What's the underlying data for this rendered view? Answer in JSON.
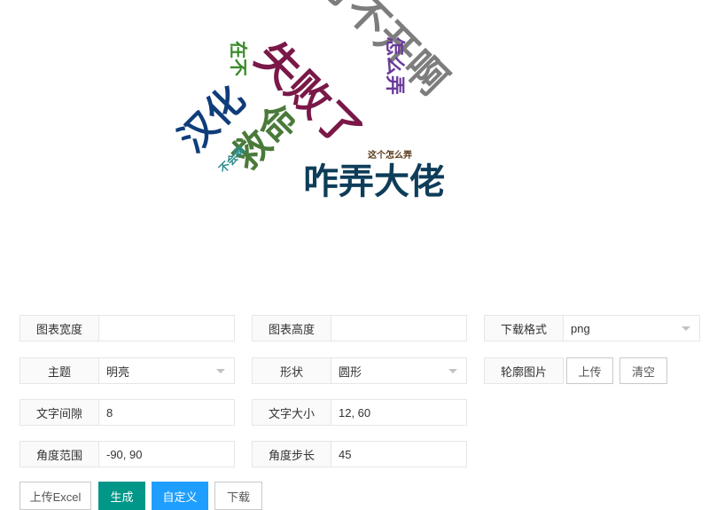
{
  "word_cloud": {
    "words": [
      {
        "text": "打不开啊",
        "color": "#7d7d7d"
      },
      {
        "text": "失败了",
        "color": "#7a1848"
      },
      {
        "text": "汉化",
        "color": "#0f3d7a"
      },
      {
        "text": "救命",
        "color": "#4a7a3a"
      },
      {
        "text": "咋弄大佬",
        "color": "#0e3d5a"
      },
      {
        "text": "怎么弄",
        "color": "#6a3a9a"
      },
      {
        "text": "在不",
        "color": "#3a8a2a"
      },
      {
        "text": "不会啊",
        "color": "#2a8a8a"
      },
      {
        "text": "这个怎么弄",
        "color": "#5a3a1a"
      }
    ]
  },
  "form": {
    "width_label": "图表宽度",
    "width_value": "",
    "height_label": "图表高度",
    "height_value": "",
    "format_label": "下载格式",
    "format_value": "png",
    "theme_label": "主题",
    "theme_value": "明亮",
    "shape_label": "形状",
    "shape_value": "圆形",
    "outline_label": "轮廓图片",
    "upload_label": "上传",
    "clear_label": "清空",
    "gap_label": "文字间隙",
    "gap_value": "8",
    "size_label": "文字大小",
    "size_value": "12, 60",
    "angle_range_label": "角度范围",
    "angle_range_value": "-90, 90",
    "angle_step_label": "角度步长",
    "angle_step_value": "45"
  },
  "actions": {
    "upload_excel": "上传Excel",
    "generate": "生成",
    "custom": "自定义",
    "download": "下载"
  }
}
